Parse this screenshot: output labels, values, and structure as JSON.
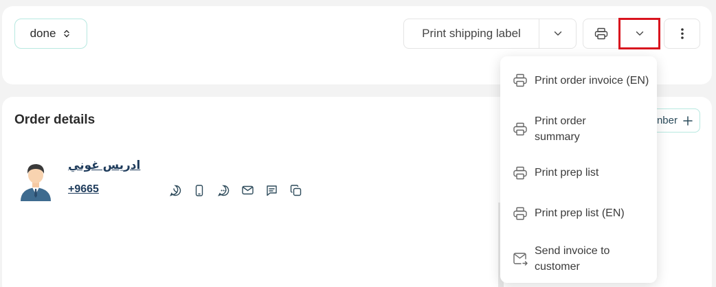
{
  "toolbar": {
    "status_label": "done",
    "print_shipping_label": "Print shipping label"
  },
  "order_details": {
    "title": "Order details",
    "add_button_partial_label": "nber"
  },
  "customer": {
    "name": "ادريس غوني",
    "phone": "+9665"
  },
  "dropdown_menu": {
    "items": [
      {
        "label": "Print order invoice (EN)",
        "icon": "printer-icon"
      },
      {
        "label": "Print order summary",
        "icon": "printer-icon"
      },
      {
        "label": "Print prep list",
        "icon": "printer-icon"
      },
      {
        "label": "Print prep list (EN)",
        "icon": "printer-icon"
      },
      {
        "label": "Send invoice to customer",
        "icon": "send-mail-icon"
      }
    ]
  },
  "colors": {
    "accent_border": "#b7e8e0",
    "highlight": "#d9141e",
    "customer_link": "#1f3c5c"
  }
}
